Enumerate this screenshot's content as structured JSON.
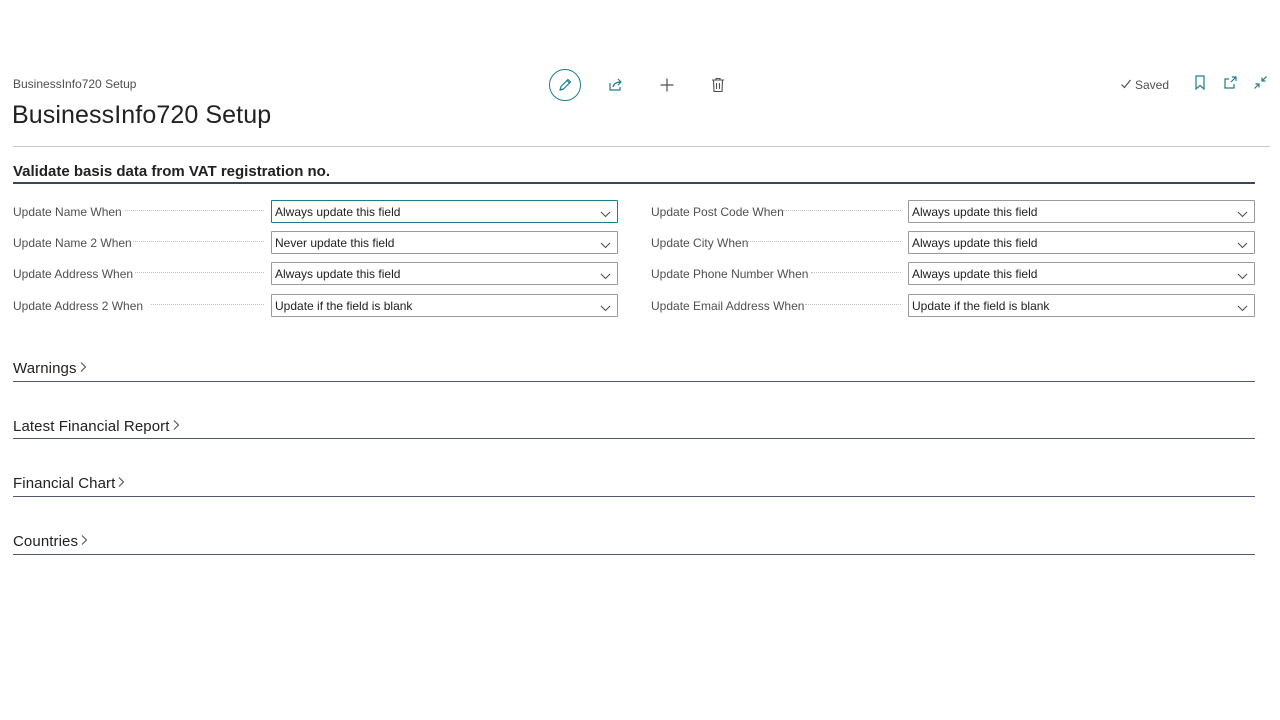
{
  "header": {
    "breadcrumb": "BusinessInfo720 Setup",
    "title": "BusinessInfo720 Setup",
    "saved_label": "Saved"
  },
  "toolbar": {
    "icons": [
      "edit-icon",
      "share-icon",
      "add-icon",
      "delete-icon"
    ]
  },
  "right_tools": {
    "icons": [
      "bookmark-icon",
      "open-new-window-icon",
      "collapse-icon"
    ]
  },
  "validate_section": {
    "title": "Validate basis data from VAT registration no.",
    "left_fields": [
      {
        "label": "Update Name When",
        "value": "Always update this field"
      },
      {
        "label": "Update Name 2 When",
        "value": "Never update this field"
      },
      {
        "label": "Update Address When",
        "value": "Always update this field"
      },
      {
        "label": "Update Address 2 When",
        "value": "Update if the field is blank"
      }
    ],
    "right_fields": [
      {
        "label": "Update Post Code When",
        "value": "Always update this field"
      },
      {
        "label": "Update City When",
        "value": "Always update this field"
      },
      {
        "label": "Update Phone Number When",
        "value": "Always update this field"
      },
      {
        "label": "Update Email Address When",
        "value": "Update if the field is blank"
      }
    ]
  },
  "collapsed_sections": [
    {
      "title": "Warnings"
    },
    {
      "title": "Latest Financial Report"
    },
    {
      "title": "Financial Chart"
    },
    {
      "title": "Countries"
    }
  ],
  "colors": {
    "accent": "#1d7d8c",
    "text": "#212121",
    "muted": "#505050"
  }
}
